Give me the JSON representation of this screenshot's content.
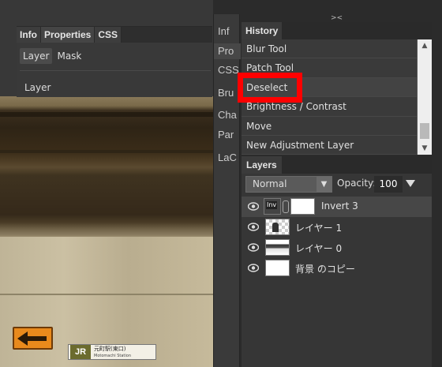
{
  "props_panel": {
    "tabs": [
      "Info",
      "Properties",
      "CSS"
    ],
    "subtabs": [
      "Layer",
      "Mask"
    ],
    "active_subtab": "Layer",
    "content_label": "Layer"
  },
  "mini_column": {
    "collapse_glyph": "<>",
    "items": [
      "Inf",
      "Pro",
      "CSS",
      "Bru",
      "Cha",
      "Par",
      "LaC"
    ]
  },
  "dock": {
    "expand_glyph": "><"
  },
  "history": {
    "tab": "History",
    "items": [
      "Blur Tool",
      "Patch Tool",
      "Deselect",
      "Brightness / Contrast",
      "Move",
      "New Adjustment Layer"
    ],
    "highlighted_item": "Deselect",
    "highlight_color": "#ff0000"
  },
  "layers": {
    "tab": "Layers",
    "blend_mode": "Normal",
    "opacity_label": "Opacity:",
    "opacity_value": "100 %",
    "rows": [
      {
        "name": "Invert 3",
        "thumb_text": "Inv",
        "selected": true
      },
      {
        "name": "レイヤー 1",
        "selected": false
      },
      {
        "name": "レイヤー 0",
        "selected": false
      },
      {
        "name": "背景 のコピー",
        "selected": false
      }
    ]
  },
  "canvas": {
    "sign_logo": "JR",
    "sign_name": "元町駅(東口)",
    "sign_sub": "Motomachi Station"
  }
}
